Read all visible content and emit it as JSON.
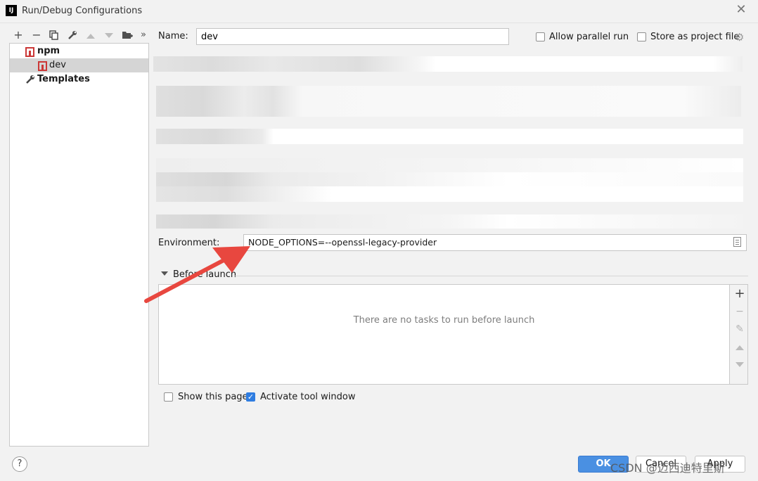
{
  "window": {
    "title": "Run/Debug Configurations",
    "app_icon_text": "IJ",
    "close_glyph": "✕"
  },
  "toolbar": {
    "icons": [
      "add-icon",
      "remove-icon",
      "copy-icon",
      "wrench-icon",
      "move-up-icon",
      "move-down-icon",
      "new-folder-icon",
      "more-icon"
    ],
    "add": "+",
    "remove": "−",
    "more": "»"
  },
  "tree": {
    "npm_label": "npm",
    "dev_label": "dev",
    "templates_label": "Templates"
  },
  "form": {
    "name_label": "Name:",
    "name_value": "dev",
    "allow_parallel_label": "Allow parallel run",
    "store_project_label": "Store as project file",
    "environment_label": "Environment:",
    "environment_value": "NODE_OPTIONS=--openssl-legacy-provider"
  },
  "before_launch": {
    "title": "Before launch",
    "empty_text": "There are no tasks to run before launch"
  },
  "options": {
    "show_page_label": "Show this page",
    "show_page_checked": false,
    "activate_tool_label": "Activate tool window",
    "activate_tool_checked": true
  },
  "buttons": {
    "help": "?",
    "ok": "OK",
    "cancel": "Cancel",
    "apply": "Apply"
  },
  "watermark": "CSDN @迈西迪特里斯",
  "colors": {
    "accent": "#4a90e2",
    "arrow": "#e8473f",
    "npm": "#cb3837"
  }
}
